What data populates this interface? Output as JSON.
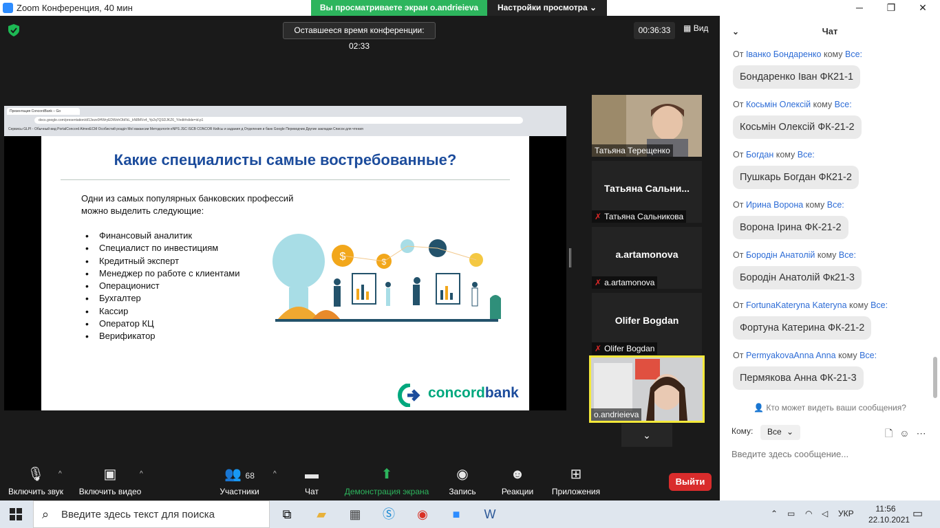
{
  "window": {
    "title": "Zoom Конференция, 40 мин",
    "minimize": "─",
    "restore": "❐",
    "close": "✕"
  },
  "banner": {
    "sharing_text": "Вы просматриваете экран o.andrieieva",
    "view_settings": "Настройки просмотра ⌄"
  },
  "meeting": {
    "remaining_time": "Оставшееся время конференции: 02:33",
    "elapsed": "00:36:33",
    "view_label": "Вид"
  },
  "browser": {
    "tab_title": "Презентация ConcordBank – Go",
    "url": "docs.google.com/presentation/d/13eze9HWryEDWohObFkL_kN8MVx4_Yp2q7QSDJKZ6_Y/edit#slide=id.p1",
    "bookmarks": "Сервисы   GLPI - Обычный вид   PortalConcord   AlmexECM   Особистий розділ   Мої вакансии   Методологія eNPS   JSC ISCB CONCOR   Кейсы и задания д   Отделения и банк   Google Переводчик   Другие закладки   Список для чтения"
  },
  "slide": {
    "title": "Какие специалисты самые востребованные?",
    "intro_line1": "Одни из самых популярных банковских профессий",
    "intro_line2": "можно выделить следующие:",
    "items": [
      "Финансовый аналитик",
      "Специалист по инвестициям",
      "Кредитный эксперт",
      "Менеджер по работе с клиентами",
      "Операционист",
      "Бухгалтер",
      "Кассир",
      "Оператор КЦ",
      "Верификатор"
    ],
    "logo_part1": "concord",
    "logo_part2": "bank"
  },
  "participants": [
    {
      "big_name": "",
      "label": "Татьяна Терещенко",
      "muted": false
    },
    {
      "big_name": "Татьяна  Сальни...",
      "label": "Татьяна Сальникова",
      "muted": true
    },
    {
      "big_name": "a.artamonova",
      "label": "a.artamonova",
      "muted": true
    },
    {
      "big_name": "Olifer Bogdan",
      "label": "Olifer Bogdan",
      "muted": true
    },
    {
      "big_name": "",
      "label": "o.andrieieva",
      "muted": false
    }
  ],
  "toolbar": {
    "unmute": "Включить звук",
    "start_video": "Включить видео",
    "participants": "Участники",
    "participants_count": "68",
    "chat": "Чат",
    "share": "Демонстрация экрана",
    "record": "Запись",
    "reactions": "Реакции",
    "apps": "Приложения",
    "leave": "Выйти"
  },
  "chat": {
    "title": "Чат",
    "from_word": "От",
    "to_word": "кому",
    "messages": [
      {
        "sender": "Іванко Бондаренко",
        "to": "Все:",
        "text": "Бондаренко Іван ФК21-1"
      },
      {
        "sender": "Косьмін Олексій",
        "to": "Все:",
        "text": "Косьмін Олексій ФК-21-2"
      },
      {
        "sender": "Богдан",
        "to": "Все:",
        "text": "Пушкарь Богдан ФК21-2"
      },
      {
        "sender": "Ирина Ворона",
        "to": "Все:",
        "text": "Ворона Ірина ФК-21-2"
      },
      {
        "sender": "Бородін Анатолій",
        "to": "Все:",
        "text": "Бородін Анатолій Фк21-3"
      },
      {
        "sender": "FortunaKateryna Kateryna",
        "to": "Все:",
        "text": "Фортуна Катерина ФК-21-2"
      },
      {
        "sender": "PermyakovaAnna Anna",
        "to": "Все:",
        "text": "Пермякова Анна ФК-21-3"
      }
    ],
    "who_can_see": "Кто может видеть ваши сообщения?",
    "to_label": "Кому:",
    "to_value": "Все",
    "input_placeholder": "Введите здесь сообщение..."
  },
  "taskbar": {
    "search_placeholder": "Введите здесь текст для поиска",
    "language": "УКР",
    "time": "11:56",
    "date": "22.10.2021"
  },
  "colors": {
    "zoom_blue": "#2d8cff",
    "share_green": "#2db55d",
    "leave_red": "#d92c2c",
    "slide_title_blue": "#1c4c9c",
    "concord_green": "#00a87e"
  }
}
